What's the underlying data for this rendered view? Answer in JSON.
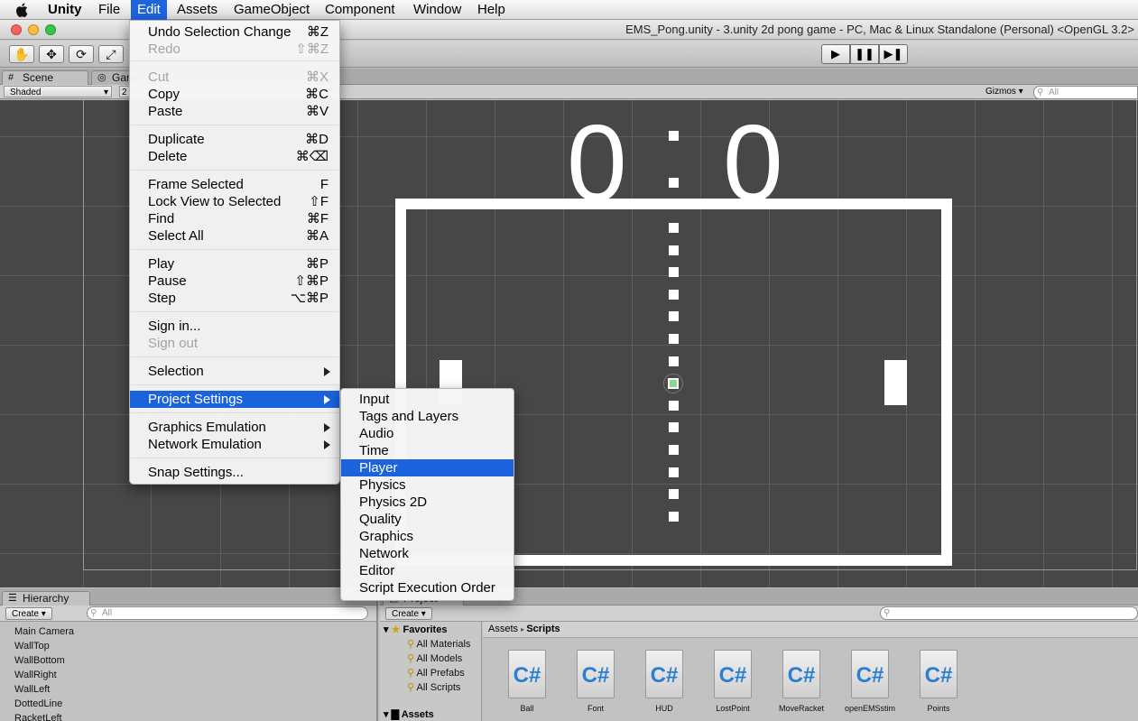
{
  "menubar": {
    "app": "Unity",
    "items": [
      "File",
      "Edit",
      "Assets",
      "GameObject",
      "Component",
      "Window",
      "Help"
    ]
  },
  "window": {
    "title": "EMS_Pong.unity - 3.unity 2d pong game - PC, Mac & Linux Standalone (Personal) <OpenGL 3.2>"
  },
  "toolbar": {
    "tools": [
      "hand-tool",
      "move-tool",
      "rotate-tool",
      "scale-tool"
    ],
    "play": [
      "play",
      "pause",
      "step"
    ]
  },
  "scene_tabs": {
    "scene": "Scene",
    "game": "Game"
  },
  "scene_options": {
    "shading": "Shaded",
    "mode": "2",
    "gizmos": "Gizmos",
    "search_placeholder": "All"
  },
  "game": {
    "score_left": "0",
    "score_sep": ":",
    "score_right": "0"
  },
  "edit_menu": {
    "items": [
      {
        "label": "Undo Selection Change",
        "shortcut": "⌘Z",
        "enabled": true
      },
      {
        "label": "Redo",
        "shortcut": "⇧⌘Z",
        "enabled": false
      },
      {
        "label": "Cut",
        "shortcut": "⌘X",
        "enabled": false
      },
      {
        "label": "Copy",
        "shortcut": "⌘C",
        "enabled": true
      },
      {
        "label": "Paste",
        "shortcut": "⌘V",
        "enabled": true
      },
      {
        "label": "Duplicate",
        "shortcut": "⌘D",
        "enabled": true
      },
      {
        "label": "Delete",
        "shortcut": "⌘⌫",
        "enabled": true
      },
      {
        "label": "Frame Selected",
        "shortcut": "F",
        "enabled": true
      },
      {
        "label": "Lock View to Selected",
        "shortcut": "⇧F",
        "enabled": true
      },
      {
        "label": "Find",
        "shortcut": "⌘F",
        "enabled": true
      },
      {
        "label": "Select All",
        "shortcut": "⌘A",
        "enabled": true
      },
      {
        "label": "Play",
        "shortcut": "⌘P",
        "enabled": true
      },
      {
        "label": "Pause",
        "shortcut": "⇧⌘P",
        "enabled": true
      },
      {
        "label": "Step",
        "shortcut": "⌥⌘P",
        "enabled": true
      },
      {
        "label": "Sign in...",
        "shortcut": "",
        "enabled": true
      },
      {
        "label": "Sign out",
        "shortcut": "",
        "enabled": false
      },
      {
        "label": "Selection",
        "shortcut": "",
        "enabled": true
      },
      {
        "label": "Project Settings",
        "shortcut": "",
        "enabled": true
      },
      {
        "label": "Graphics Emulation",
        "shortcut": "",
        "enabled": true
      },
      {
        "label": "Network Emulation",
        "shortcut": "",
        "enabled": true
      },
      {
        "label": "Snap Settings...",
        "shortcut": "",
        "enabled": true
      }
    ]
  },
  "project_settings_menu": {
    "items": [
      "Input",
      "Tags and Layers",
      "Audio",
      "Time",
      "Player",
      "Physics",
      "Physics 2D",
      "Quality",
      "Graphics",
      "Network",
      "Editor",
      "Script Execution Order"
    ],
    "selected": "Player"
  },
  "hierarchy": {
    "tab": "Hierarchy",
    "create": "Create",
    "search_placeholder": "All",
    "items": [
      "Main Camera",
      "WallTop",
      "WallBottom",
      "WallRight",
      "WallLeft",
      "DottedLine",
      "RacketLeft"
    ]
  },
  "project": {
    "tab": "Project",
    "create": "Create",
    "favorites_label": "Favorites",
    "favorites": [
      "All Materials",
      "All Models",
      "All Prefabs",
      "All Scripts"
    ],
    "assets_label": "Assets",
    "breadcrumb": [
      "Assets",
      "Scripts"
    ],
    "files": [
      "Ball",
      "Font",
      "HUD",
      "LostPoint",
      "MoveRacket",
      "openEMSstim",
      "Points"
    ],
    "file_icon_text": "C#"
  },
  "colors": {
    "menu_highlight": "#1b63dc",
    "scene_bg": "#474747",
    "court": "#ffffff"
  }
}
